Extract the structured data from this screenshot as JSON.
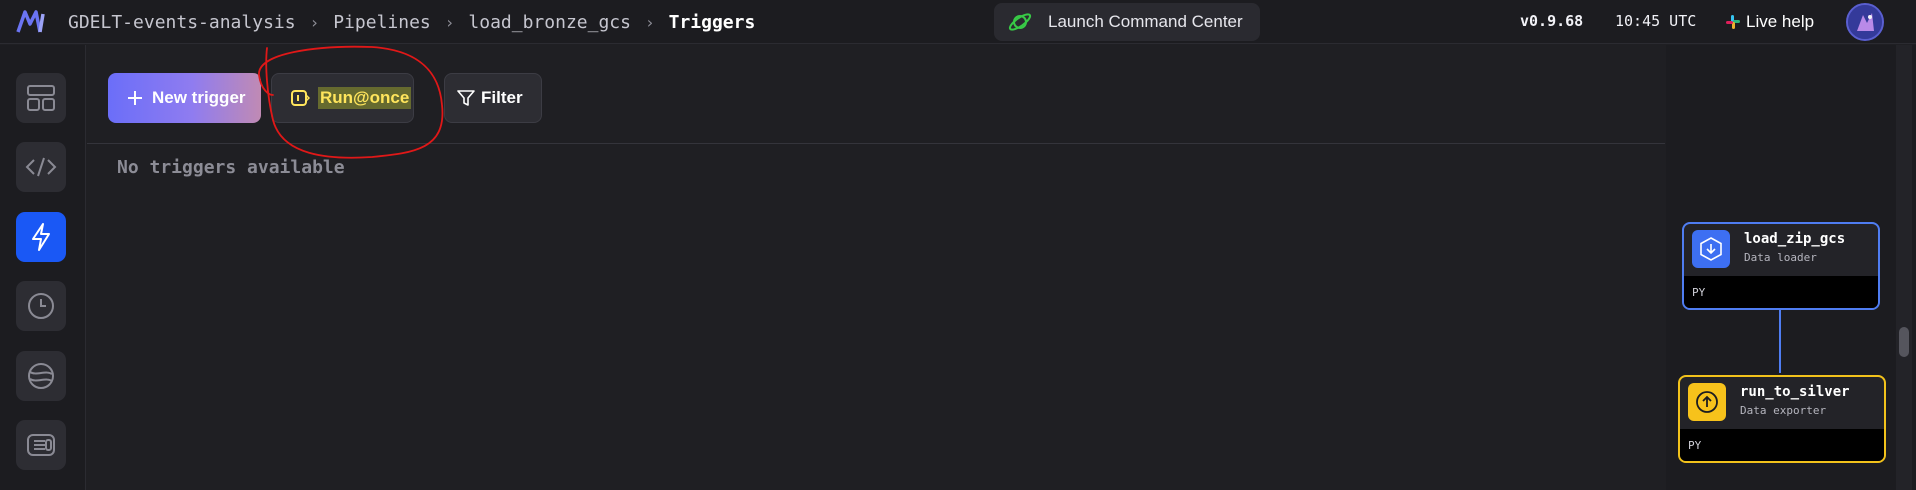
{
  "app": {
    "breadcrumb": [
      "GDELT-events-analysis",
      "Pipelines",
      "load_bronze_gcs"
    ],
    "current_page": "Triggers"
  },
  "header": {
    "launch_label": "Launch Command Center",
    "version": "v0.9.68",
    "time": "10:45 UTC",
    "live_help": "Live help"
  },
  "sidebar": {
    "items": [
      {
        "icon": "layout-icon",
        "active": false
      },
      {
        "icon": "code-icon",
        "active": false
      },
      {
        "icon": "lightning-icon",
        "active": true
      },
      {
        "icon": "clock-icon",
        "active": false
      },
      {
        "icon": "globe-icon",
        "active": false
      },
      {
        "icon": "terminal-icon",
        "active": false
      }
    ]
  },
  "toolbar": {
    "new_trigger": "New trigger",
    "run_once": "Run@once",
    "filter": "Filter"
  },
  "main": {
    "empty_message": "No triggers available"
  },
  "graph": {
    "nodes": [
      {
        "name": "load_zip_gcs",
        "type": "Data loader",
        "lang": "PY",
        "color": "#4f7df2"
      },
      {
        "name": "run_to_silver",
        "type": "Data exporter",
        "lang": "PY",
        "color": "#f2c21b"
      }
    ]
  },
  "colors": {
    "accent_blue": "#1a58f5",
    "highlight_yellow": "#ffe55c",
    "annotation_red": "#e01818"
  }
}
